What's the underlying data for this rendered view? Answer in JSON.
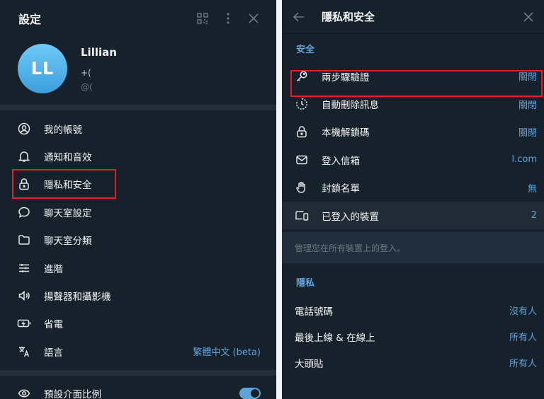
{
  "left": {
    "title": "設定",
    "profile": {
      "initials": "LL",
      "name": "Lillian",
      "phone": "+(",
      "username": "@("
    },
    "items": [
      {
        "icon": "user-circle-icon",
        "label": "我的帳號"
      },
      {
        "icon": "bell-icon",
        "label": "通知和音效"
      },
      {
        "icon": "lock-icon",
        "label": "隱私和安全"
      },
      {
        "icon": "chat-bubble-icon",
        "label": "聊天室設定"
      },
      {
        "icon": "folder-icon",
        "label": "聊天室分類"
      },
      {
        "icon": "sliders-icon",
        "label": "進階"
      },
      {
        "icon": "speaker-icon",
        "label": "揚聲器和攝影機"
      },
      {
        "icon": "battery-icon",
        "label": "省電"
      },
      {
        "icon": "translate-icon",
        "label": "語言",
        "value": "繁體中文 (beta)"
      }
    ],
    "scale": {
      "icon": "eye-icon",
      "label": "預設介面比例",
      "toggle_on": true
    }
  },
  "right": {
    "title": "隱私和安全",
    "security_title": "安全",
    "security_items": [
      {
        "icon": "key-icon",
        "label": "兩步驟驗證",
        "value": "關閉"
      },
      {
        "icon": "timer-icon",
        "label": "自動刪除訊息",
        "value": "關閉"
      },
      {
        "icon": "lock-icon",
        "label": "本機解鎖碼",
        "value": "關閉"
      },
      {
        "icon": "mail-icon",
        "label": "登入信箱",
        "value": "l.com"
      },
      {
        "icon": "hand-icon",
        "label": "封鎖名單",
        "value": "無"
      },
      {
        "icon": "devices-icon",
        "label": "已登入的裝置",
        "value": "2"
      }
    ],
    "sessions_hint": "管理您在所有裝置上的登入。",
    "privacy_title": "隱私",
    "privacy_items": [
      {
        "label": "電話號碼",
        "value": "沒有人"
      },
      {
        "label": "最後上線 & 在線上",
        "value": "所有人"
      },
      {
        "label": "大頭貼",
        "value": "所有人"
      }
    ]
  },
  "colors": {
    "panel_bg": "#17212b",
    "separator": "#232e3c",
    "accent": "#5fa4d9",
    "muted": "#6d7883",
    "highlight_box": "#e0202a"
  }
}
